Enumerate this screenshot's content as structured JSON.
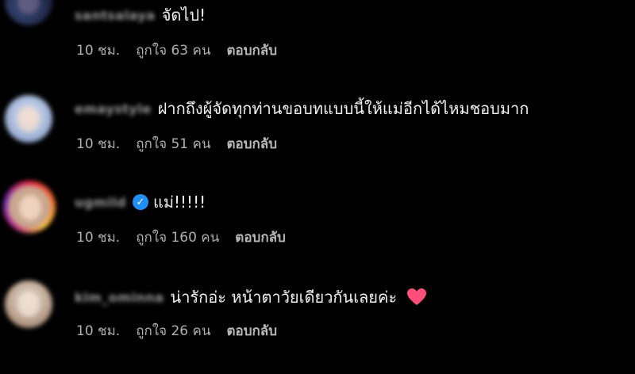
{
  "comments": [
    {
      "username": "santsalaya",
      "text": "จัดไป!",
      "time": "10 ชม.",
      "likes": "ถูกใจ 63 คน",
      "reply": "ตอบกลับ",
      "verified": false,
      "heart": false
    },
    {
      "username": "emaystyle",
      "text": "ฝากถึงผู้จัดทุกท่านขอบทแบบนี้ให้แม่อีกได้ไหมชอบมาก",
      "time": "10 ชม.",
      "likes": "ถูกใจ 51 คน",
      "reply": "ตอบกลับ",
      "verified": false,
      "heart": false
    },
    {
      "username": "ugmild",
      "text": "แม่!!!!!",
      "time": "10 ชม.",
      "likes": "ถูกใจ 160 คน",
      "reply": "ตอบกลับ",
      "verified": true,
      "heart": false
    },
    {
      "username": "kim_ominna",
      "text": "น่ารักอ่ะ หน้าตาวัยเดียวกันเลยค่ะ",
      "time": "10 ชม.",
      "likes": "ถูกใจ 26 คน",
      "reply": "ตอบกลับ",
      "verified": false,
      "heart": true
    }
  ],
  "colors": {
    "background": "#000000",
    "verified_badge": "#1f8ff5",
    "heart": "#ff4f7a"
  }
}
